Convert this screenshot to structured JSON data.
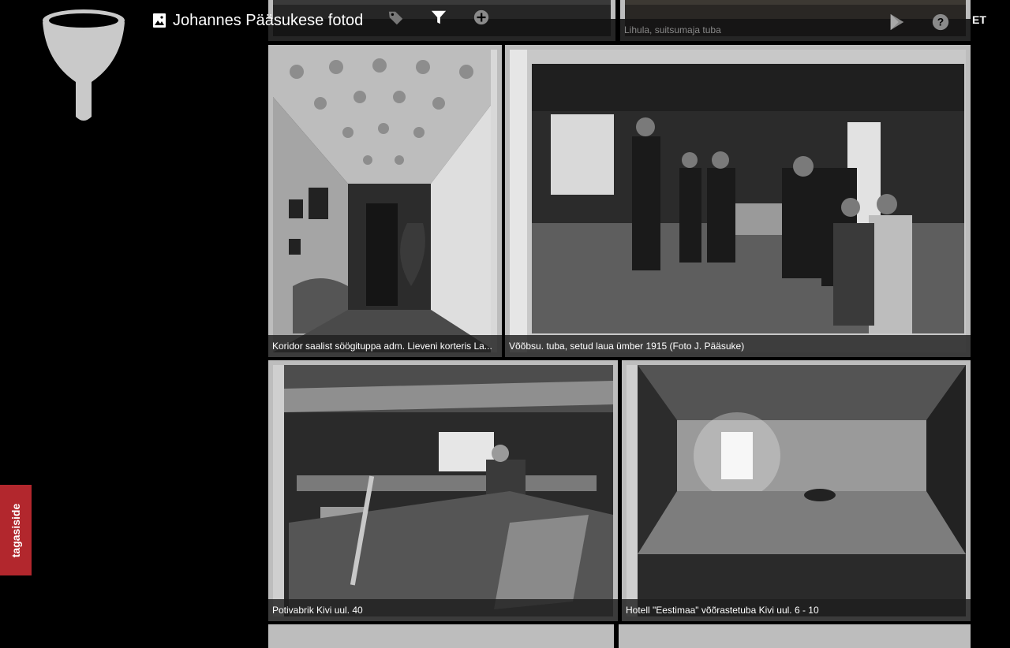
{
  "header": {
    "title": "Johannes Pääsukese fotod",
    "icons": {
      "album": "album-icon",
      "tag": "tag-icon",
      "filter": "filter-icon",
      "add": "add-icon",
      "play_store": "play-store-icon",
      "help": "help-icon",
      "logo": "funnel-logo"
    },
    "language": "ET"
  },
  "photos": {
    "top_left": {
      "caption": ""
    },
    "top_right": {
      "caption": "Lihula, suitsumaja tuba"
    },
    "koridor": {
      "caption": "Koridor saalist söögituppa adm. Lieveni korteris La..."
    },
    "voobsu": {
      "caption": "Võõbsu. tuba, setud laua ümber 1915 (Foto J. Pääsuke)"
    },
    "potivabrik": {
      "caption": "Potivabrik Kivi uul. 40"
    },
    "hotell": {
      "caption": "Hotell \"Eestimaa\" võõrastetuba Kivi uul. 6 - 10"
    }
  },
  "feedback": {
    "label": "tagasiside"
  },
  "colors": {
    "background": "#000000",
    "feedback": "#b2272d",
    "caption_bg": "#1e1e1e"
  }
}
